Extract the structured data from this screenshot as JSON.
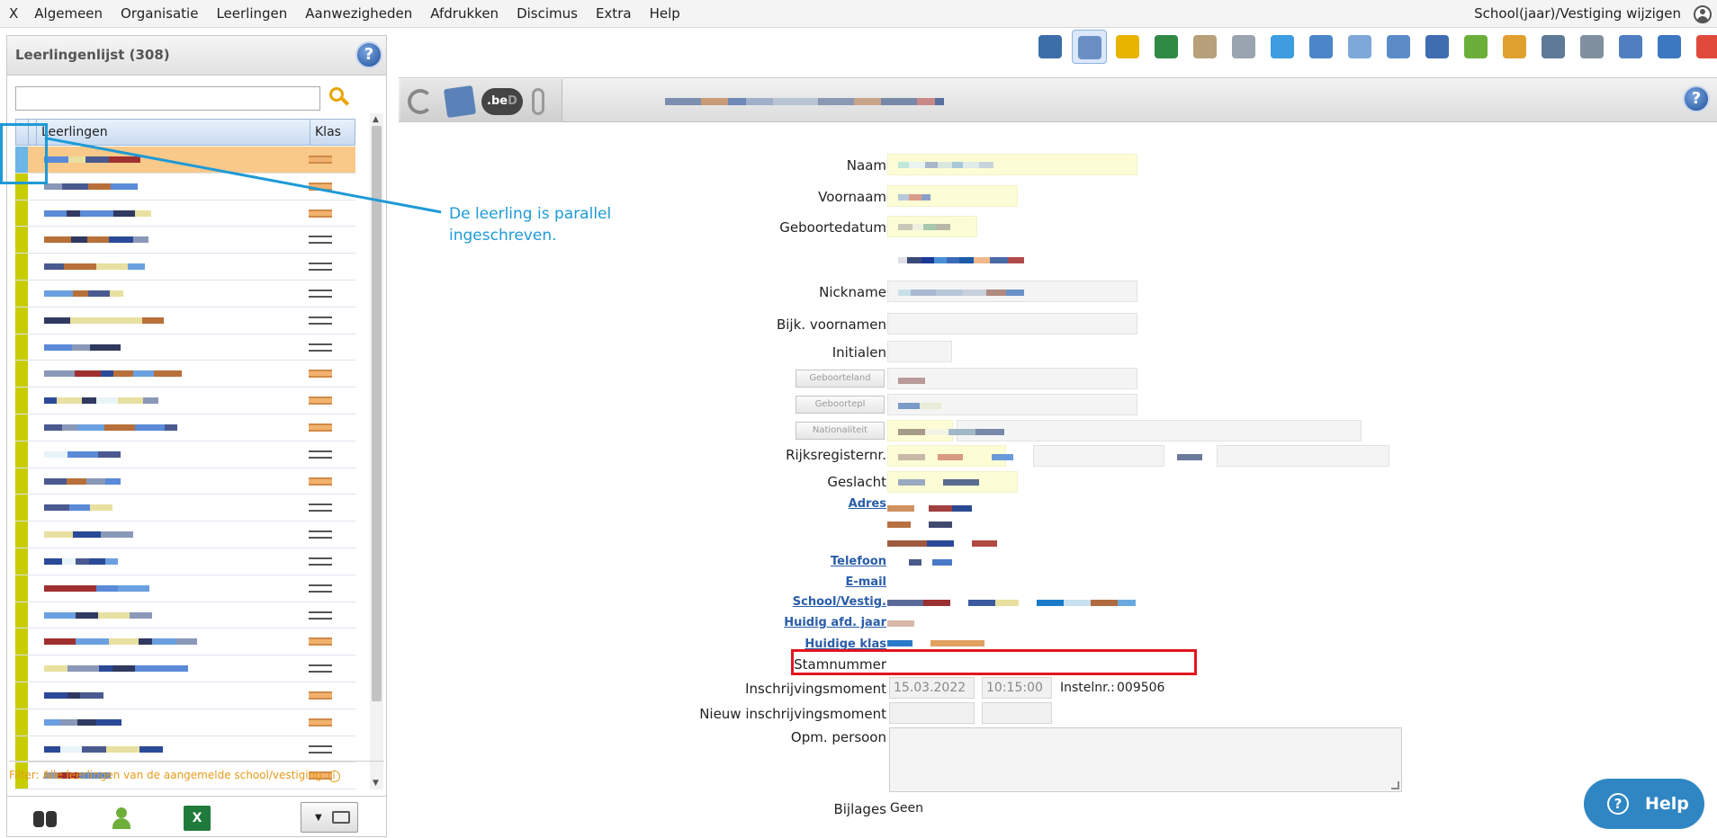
{
  "menu": {
    "close": "X",
    "items": [
      "Algemeen",
      "Organisatie",
      "Leerlingen",
      "Aanwezigheden",
      "Afdrukken",
      "Discimus",
      "Extra",
      "Help"
    ],
    "right_link": "School(jaar)/Vestiging wijzigen"
  },
  "leftpanel": {
    "title": "Leerlingenlijst (308)",
    "help": "?",
    "search_value": "",
    "columns": {
      "name": "Leerlingen",
      "klas": "Klas"
    },
    "filter_text": "Filter: Alle leerlingen van de aangemelde school/vestiging",
    "filter_info": "i"
  },
  "toolbar": {
    "bed_label": ".be",
    "bed_suffix": "D",
    "help": "?"
  },
  "form": {
    "naam": "Naam",
    "voornaam": "Voornaam",
    "geboortedatum": "Geboortedatum",
    "nickname": "Nickname",
    "bijk_voornamen": "Bijk.  voornamen",
    "initialen": "Initialen",
    "geboorteland_btn": "Geboorteland",
    "geboortepl_btn": "Geboortepl",
    "nationaliteit_btn": "Nationaliteit",
    "rijksregisternr": "Rijksregisternr.",
    "geslacht": "Geslacht",
    "adres": "Adres",
    "telefoon": "Telefoon",
    "email": "E-mail",
    "school_vestig": "School/Vestig.",
    "huidig_afd_jaar": "Huidig afd. jaar",
    "huidige_klas": "Huidige klas",
    "stamnummer": "Stamnummer",
    "inschrijvingsmoment": "Inschrijvingsmoment",
    "inschrijving_datum": "15.03.2022",
    "inschrijving_tijd": "10:15:00",
    "instelnr_label": "Instelnr.:",
    "instelnr_value": "009506",
    "nieuw_inschrijvingsmoment": "Nieuw inschrijvingsmoment",
    "opm_persoon": "Opm.  persoon",
    "bijlages_label": "Bijlages",
    "bijlages_value": "Geen"
  },
  "annotation": {
    "text": "De leerling is parallel ingeschreven.",
    "color_blue": "#1e9ad6",
    "color_red": "#e3161e"
  },
  "help_button": {
    "label": "Help",
    "q": "?"
  }
}
